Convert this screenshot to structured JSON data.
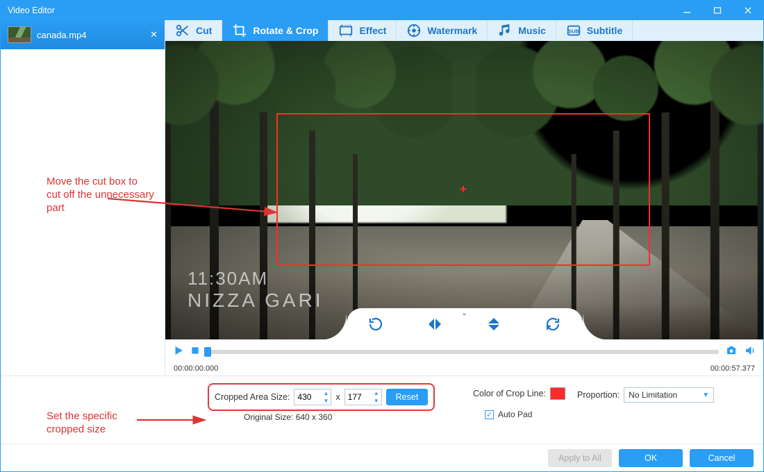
{
  "window": {
    "title": "Video Editor"
  },
  "file": {
    "name": "canada.mp4"
  },
  "tabs": {
    "cut": "Cut",
    "rotate_crop": "Rotate & Crop",
    "effect": "Effect",
    "watermark": "Watermark",
    "music": "Music",
    "subtitle": "Subtitle"
  },
  "overlay": {
    "time": "11:30AM",
    "place": "NIZZA GARI"
  },
  "playbar": {
    "current": "00:00:00.000",
    "total": "00:00:57.377"
  },
  "settings": {
    "cropped_label": "Cropped Area Size:",
    "width": "430",
    "height": "177",
    "x": "x",
    "reset": "Reset",
    "original_label": "Original Size: 640 x 360",
    "crop_line_label": "Color of Crop Line:",
    "crop_line_color": "#ff2a2a",
    "proportion_label": "Proportion:",
    "proportion_value": "No Limitation",
    "autopad_label": "Auto Pad",
    "autopad_checked": true
  },
  "footer": {
    "apply": "Apply to All",
    "ok": "OK",
    "cancel": "Cancel"
  },
  "annotations": {
    "move_box": "Move the cut box to cut off the unnecessary part",
    "set_size": "Set the specific cropped size"
  }
}
